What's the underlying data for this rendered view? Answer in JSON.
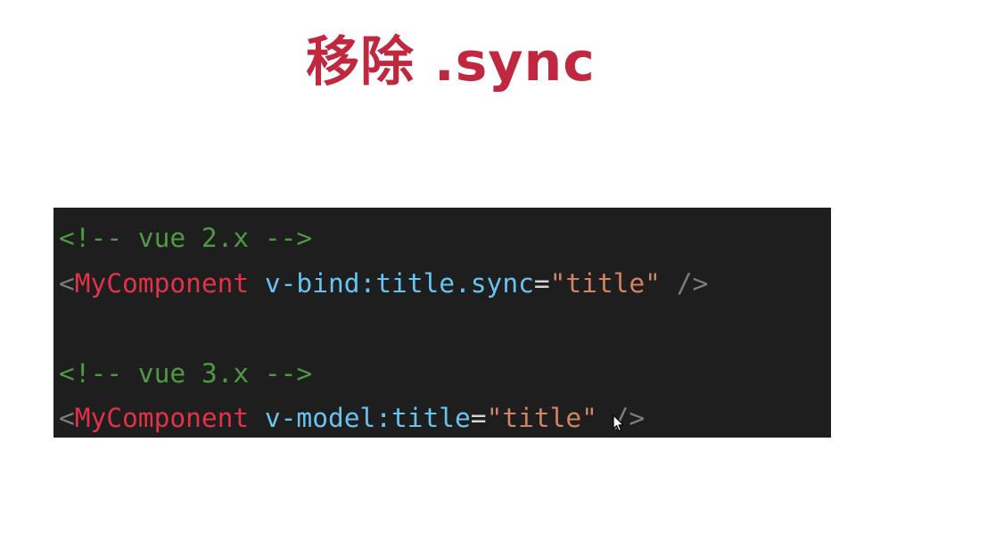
{
  "slide": {
    "title": "移除 .sync"
  },
  "code": {
    "lines": [
      {
        "comment": "<!-- vue 2.x -->"
      },
      {
        "open": "<",
        "tag": "MyComponent",
        "space": " ",
        "attr": "v-bind:title.sync",
        "eq": "=",
        "value": "\"title\"",
        "close": " />"
      },
      {
        "blank": ""
      },
      {
        "comment": "<!-- vue 3.x -->"
      },
      {
        "open": "<",
        "tag": "MyComponent",
        "space": " ",
        "attr": "v-model:title",
        "eq": "=",
        "value": "\"title\"",
        "close": " />"
      }
    ]
  },
  "colors": {
    "title": "#c0283f",
    "code_background": "#1e1e1e",
    "comment": "#4e9a43",
    "tag": "#e23148",
    "attribute": "#6ac3ee",
    "string": "#d18364",
    "punctuation": "#7c7c7c"
  },
  "icons": {
    "cursor": "mouse-pointer-icon"
  }
}
